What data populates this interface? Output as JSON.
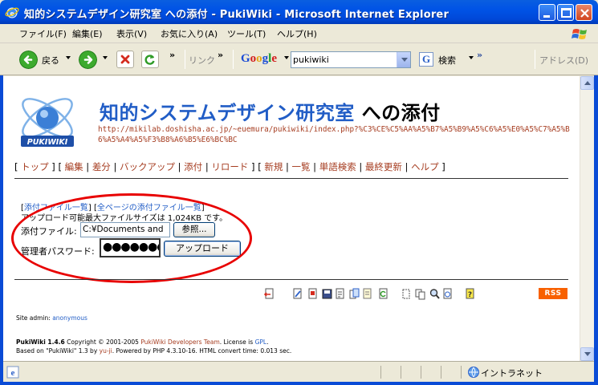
{
  "window": {
    "title": "知的システムデザイン研究室 への添付 - PukiWiki - Microsoft Internet Explorer"
  },
  "menu": {
    "items": [
      "ファイル(F)",
      "編集(E)",
      "表示(V)",
      "お気に入り(A)",
      "ツール(T)",
      "ヘルプ(H)"
    ]
  },
  "toolbar": {
    "back_label": "戻る",
    "links_label": "リンク",
    "more": "»",
    "search_value": "pukiwiki",
    "search_label": "検索",
    "address_label": "アドレス(D)"
  },
  "page": {
    "logo_text": "PUKIWIKI",
    "title_main": "知的システムデザイン研究室",
    "title_suffix": " への添付",
    "url": "http://mikilab.doshisha.ac.jp/~euemura/pukiwiki/index.php?%C3%CE%C5%AA%A5%B7%A5%B9%A5%C6%A5%E0%A5%C7%A5%B6%A5%A4%A5%F3%B8%A6%B5%E6%BC%BC",
    "nav": {
      "open1": "[ ",
      "group1": [
        "トップ"
      ],
      "close1": " ] ",
      "open2": " [ ",
      "group2": [
        "編集",
        "差分",
        "バックアップ",
        "添付",
        "リロード"
      ],
      "close2": " ] ",
      "open3": " [ ",
      "group3": [
        "新規",
        "一覧",
        "単語検索",
        "最終更新",
        "ヘルプ"
      ],
      "close3": " ]"
    },
    "attach_links": [
      "添付ファイル一覧",
      "全ページの添付ファイル一覧"
    ],
    "max_size": "アップロード可能最大ファイルサイズは 1,024KB です。",
    "file_label": "添付ファイル:",
    "file_value": "C:¥Documents and",
    "browse_label": "参照...",
    "password_label": "管理者パスワード:",
    "password_value": "●●●●●●●●",
    "upload_label": "アップロード",
    "rss": "RSS",
    "site_admin_label": "Site admin: ",
    "site_admin_name": "anonymous",
    "footer": {
      "line1_a": "PukiWiki 1.4.6",
      "line1_b": " Copyright © 2001-2005 ",
      "line1_c": "PukiWiki Developers Team",
      "line1_d": ". License is ",
      "line1_e": "GPL",
      "line1_f": ".",
      "line2_a": "Based on \"PukiWiki\" 1.3 by ",
      "line2_b": "yu-ji",
      "line2_c": ". Powered by PHP 4.3.10-16. HTML convert time: 0.013 sec."
    }
  },
  "status": {
    "zone": "イントラネット"
  },
  "colors": {
    "titlebar": "#0053E6",
    "link_red": "#A63D21",
    "link_blue": "#215DC6",
    "annotation": "#E80000",
    "rss": "#F86000"
  }
}
